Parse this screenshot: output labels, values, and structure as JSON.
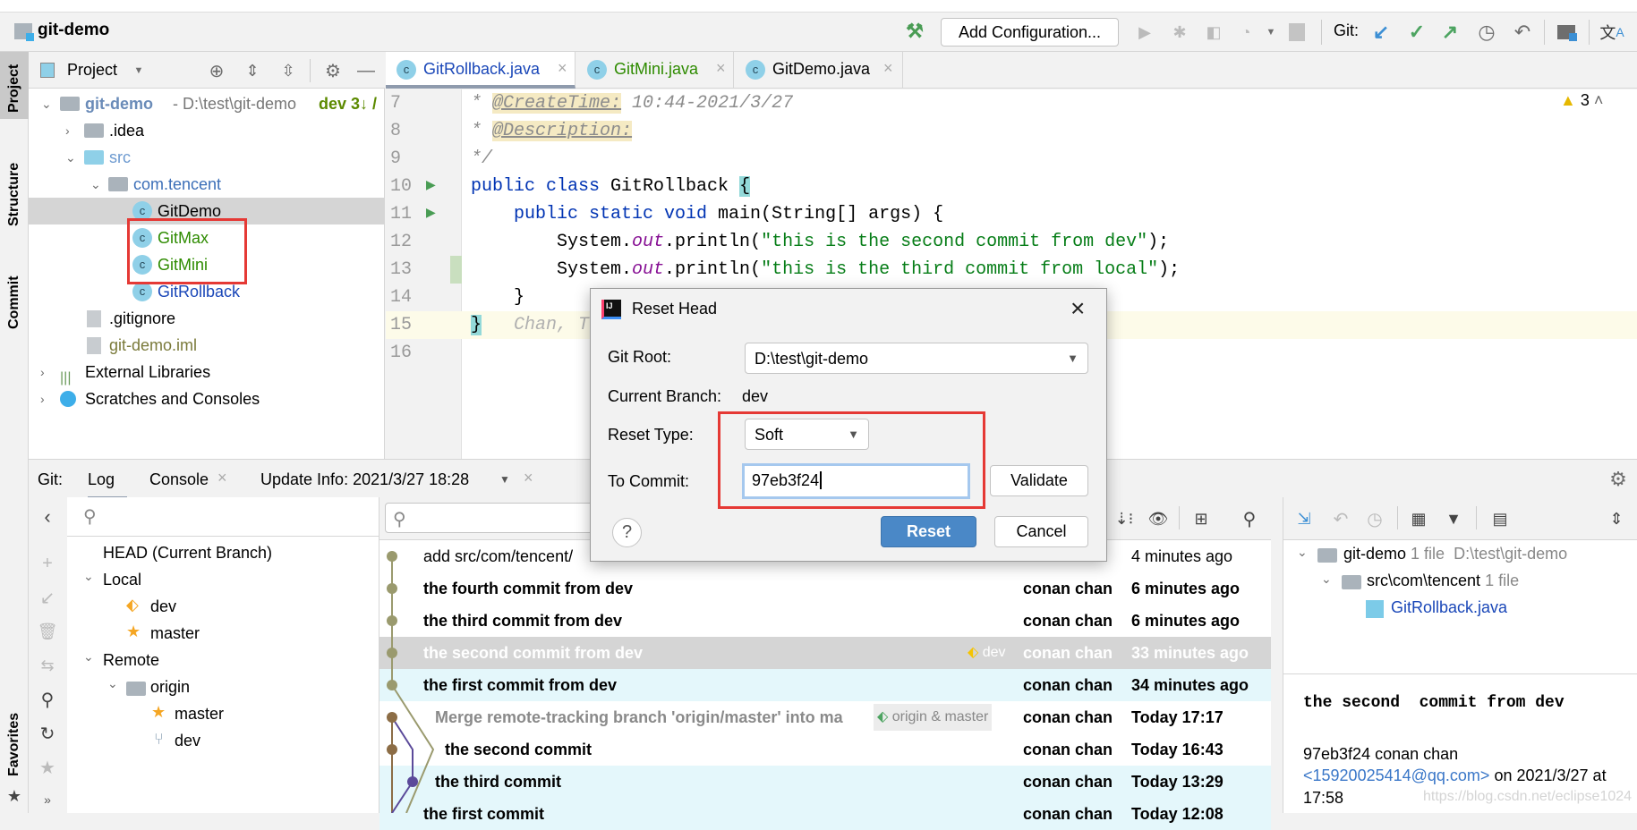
{
  "window": {
    "project_name": "git-demo"
  },
  "toolbar": {
    "add_configuration": "Add Configuration...",
    "git_label": "Git:",
    "warning_count": "3"
  },
  "side_tabs": {
    "project": "Project",
    "structure": "Structure",
    "commit": "Commit",
    "favorites": "Favorites"
  },
  "project_panel": {
    "title": "Project",
    "tree": [
      {
        "label": "git-demo",
        "path": "- D:\\test\\git-demo",
        "branch": "dev 3↓ /"
      },
      {
        "label": ".idea"
      },
      {
        "label": "src"
      },
      {
        "label": "com.tencent"
      },
      {
        "label": "GitDemo"
      },
      {
        "label": "GitMax"
      },
      {
        "label": "GitMini"
      },
      {
        "label": "GitRollback"
      },
      {
        "label": ".gitignore"
      },
      {
        "label": "git-demo.iml"
      },
      {
        "label": "External Libraries"
      },
      {
        "label": "Scratches and Consoles"
      }
    ]
  },
  "editor": {
    "tabs": [
      {
        "label": "GitRollback.java",
        "active": true
      },
      {
        "label": "GitMini.java"
      },
      {
        "label": "GitDemo.java"
      }
    ],
    "lines": [
      {
        "n": "7",
        "a": " * ",
        "b": "@CreateTime:",
        "c": " 10:44-2021/3/27"
      },
      {
        "n": "8",
        "a": " * ",
        "b": "@Description:"
      },
      {
        "n": "9",
        "a": " */"
      },
      {
        "n": "10",
        "kw": "public class ",
        "t": "GitRollback ",
        "brace": "{"
      },
      {
        "n": "11",
        "kw": "    public static void ",
        "t": "main(String[] args) {"
      },
      {
        "n": "12",
        "pre": "        System.",
        "out": "out",
        "mid": ".println(",
        "str": "\"this is the second commit from dev\"",
        "end": ");"
      },
      {
        "n": "13",
        "pre": "        System.",
        "out": "out",
        "mid": ".println(",
        "str": "\"this is the third commit from local\"",
        "end": ");"
      },
      {
        "n": "14",
        "t": "    }"
      },
      {
        "n": "15",
        "brace": "}",
        "hint": "   Chan, To"
      },
      {
        "n": "16"
      }
    ]
  },
  "dialog": {
    "title": "Reset Head",
    "git_root_label": "Git Root:",
    "git_root_value": "D:\\test\\git-demo",
    "current_branch_label": "Current Branch:",
    "current_branch_value": "dev",
    "reset_type_label": "Reset Type:",
    "reset_type_value": "Soft",
    "to_commit_label": "To Commit:",
    "to_commit_value": "97eb3f24",
    "validate": "Validate",
    "reset": "Reset",
    "cancel": "Cancel",
    "help": "?"
  },
  "git_panel": {
    "label": "Git:",
    "tabs": [
      {
        "label": "Log",
        "active": true
      },
      {
        "label": "Console"
      },
      {
        "label": "Update Info: 2021/3/27 18:28"
      }
    ],
    "branches": {
      "head": "HEAD (Current Branch)",
      "local": "Local",
      "local_items": [
        "dev",
        "master"
      ],
      "remote": "Remote",
      "origin": "origin",
      "remote_items": [
        "master",
        "dev"
      ]
    },
    "log": [
      {
        "message": "add src/com/tencent/",
        "author": "",
        "date": "4 minutes ago"
      },
      {
        "message": "the fourth  commit from dev",
        "author": "conan chan",
        "date": "6 minutes ago"
      },
      {
        "message": "the third  commit from dev",
        "author": "conan chan",
        "date": "6 minutes ago"
      },
      {
        "message": "the second  commit from dev",
        "tag": "dev",
        "author": "conan chan",
        "date": "33 minutes ago"
      },
      {
        "message": "the first  commit from dev",
        "author": "conan chan",
        "date": "34 minutes ago"
      },
      {
        "message": "Merge remote-tracking branch 'origin/master' into ma",
        "tag": "origin & master",
        "author": "conan chan",
        "date": "Today 17:17"
      },
      {
        "message": "the second commit",
        "author": "conan chan",
        "date": "Today 16:43"
      },
      {
        "message": "the third commit",
        "author": "conan chan",
        "date": "Today 13:29"
      },
      {
        "message": "the first commit",
        "author": "conan chan",
        "date": "Today 12:08"
      }
    ],
    "details": {
      "root": "git-demo",
      "root_count": "1 file",
      "root_path": "D:\\test\\git-demo",
      "dir": "src\\com\\tencent",
      "dir_count": "1 file",
      "file": "GitRollback.java",
      "commit_message": "the second  commit from dev",
      "hash_author": "97eb3f24 conan chan",
      "email": "<15920025414@qq.com>",
      "date_text": " on 2021/3/27 at",
      "time": "17:58"
    },
    "watermark": "https://blog.csdn.net/eclipse1024"
  },
  "colors": {
    "accent": "#4a88c7",
    "highlight_red": "#e53935",
    "selected_row": "#d5d5d5",
    "cyan_row": "#e4f7fb"
  }
}
